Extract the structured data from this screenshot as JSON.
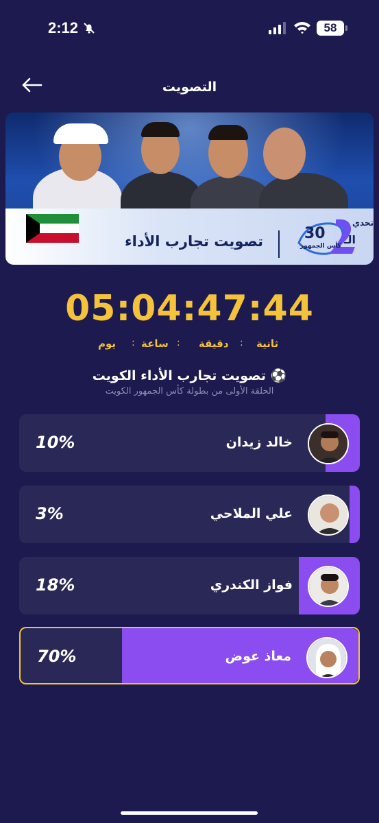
{
  "status": {
    "time": "2:12",
    "battery": "58"
  },
  "header": {
    "title": "التصويت"
  },
  "banner": {
    "title": "تصويت تجارب الأداء",
    "logo_number": "30",
    "logo_word": "تحدي",
    "logo_sub": "كأس الجمهور",
    "logo_letter": "الـ"
  },
  "countdown": {
    "value": "05:04:47:44",
    "units": {
      "second": "ثانية",
      "minute": "دقيقة",
      "hour": "ساعة",
      "day": "يوم"
    },
    "separator": ":"
  },
  "poll": {
    "title": "⚽ تصويت تجارب الأداء الكويت",
    "subtitle": "الحلقة الأولى من بطولة كأس الجمهور الكويت",
    "options": [
      {
        "name": "خالد زيدان",
        "percent_label": "10%",
        "percent": 10,
        "selected": false
      },
      {
        "name": "علي الملاحي",
        "percent_label": "3%",
        "percent": 3,
        "selected": false
      },
      {
        "name": "فواز الكندري",
        "percent_label": "18%",
        "percent": 18,
        "selected": false
      },
      {
        "name": "معاذ عوض",
        "percent_label": "70%",
        "percent": 70,
        "selected": true
      }
    ]
  },
  "colors": {
    "background": "#1c1a4e",
    "card": "#2a2857",
    "accent_purple": "#8b4cf0",
    "countdown_yellow": "#f4c33b"
  }
}
